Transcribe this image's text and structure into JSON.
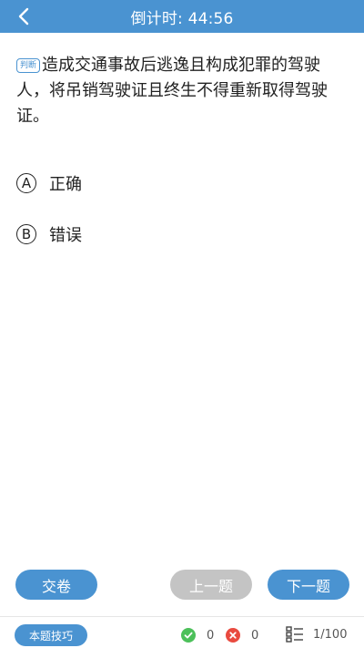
{
  "header": {
    "title": "倒计时: 44:56",
    "background": "#4a93d1"
  },
  "question": {
    "type_tag": "判断",
    "text": "造成交通事故后逃逸且构成犯罪的驾驶人，将吊销驾驶证且终生不得重新取得驾驶证。",
    "options": [
      {
        "letter": "A",
        "label": "正确"
      },
      {
        "letter": "B",
        "label": "错误"
      }
    ]
  },
  "actions": {
    "submit_label": "交卷",
    "prev_label": "上一题",
    "next_label": "下一题"
  },
  "bottom": {
    "tips_label": "本题技巧",
    "correct_count": "0",
    "wrong_count": "0",
    "progress": "1/100",
    "correct_icon": "check-circle-icon",
    "wrong_icon": "x-circle-icon",
    "grid_icon": "question-list-icon",
    "correct_color": "#4cc05a",
    "wrong_color": "#e94a3f"
  }
}
